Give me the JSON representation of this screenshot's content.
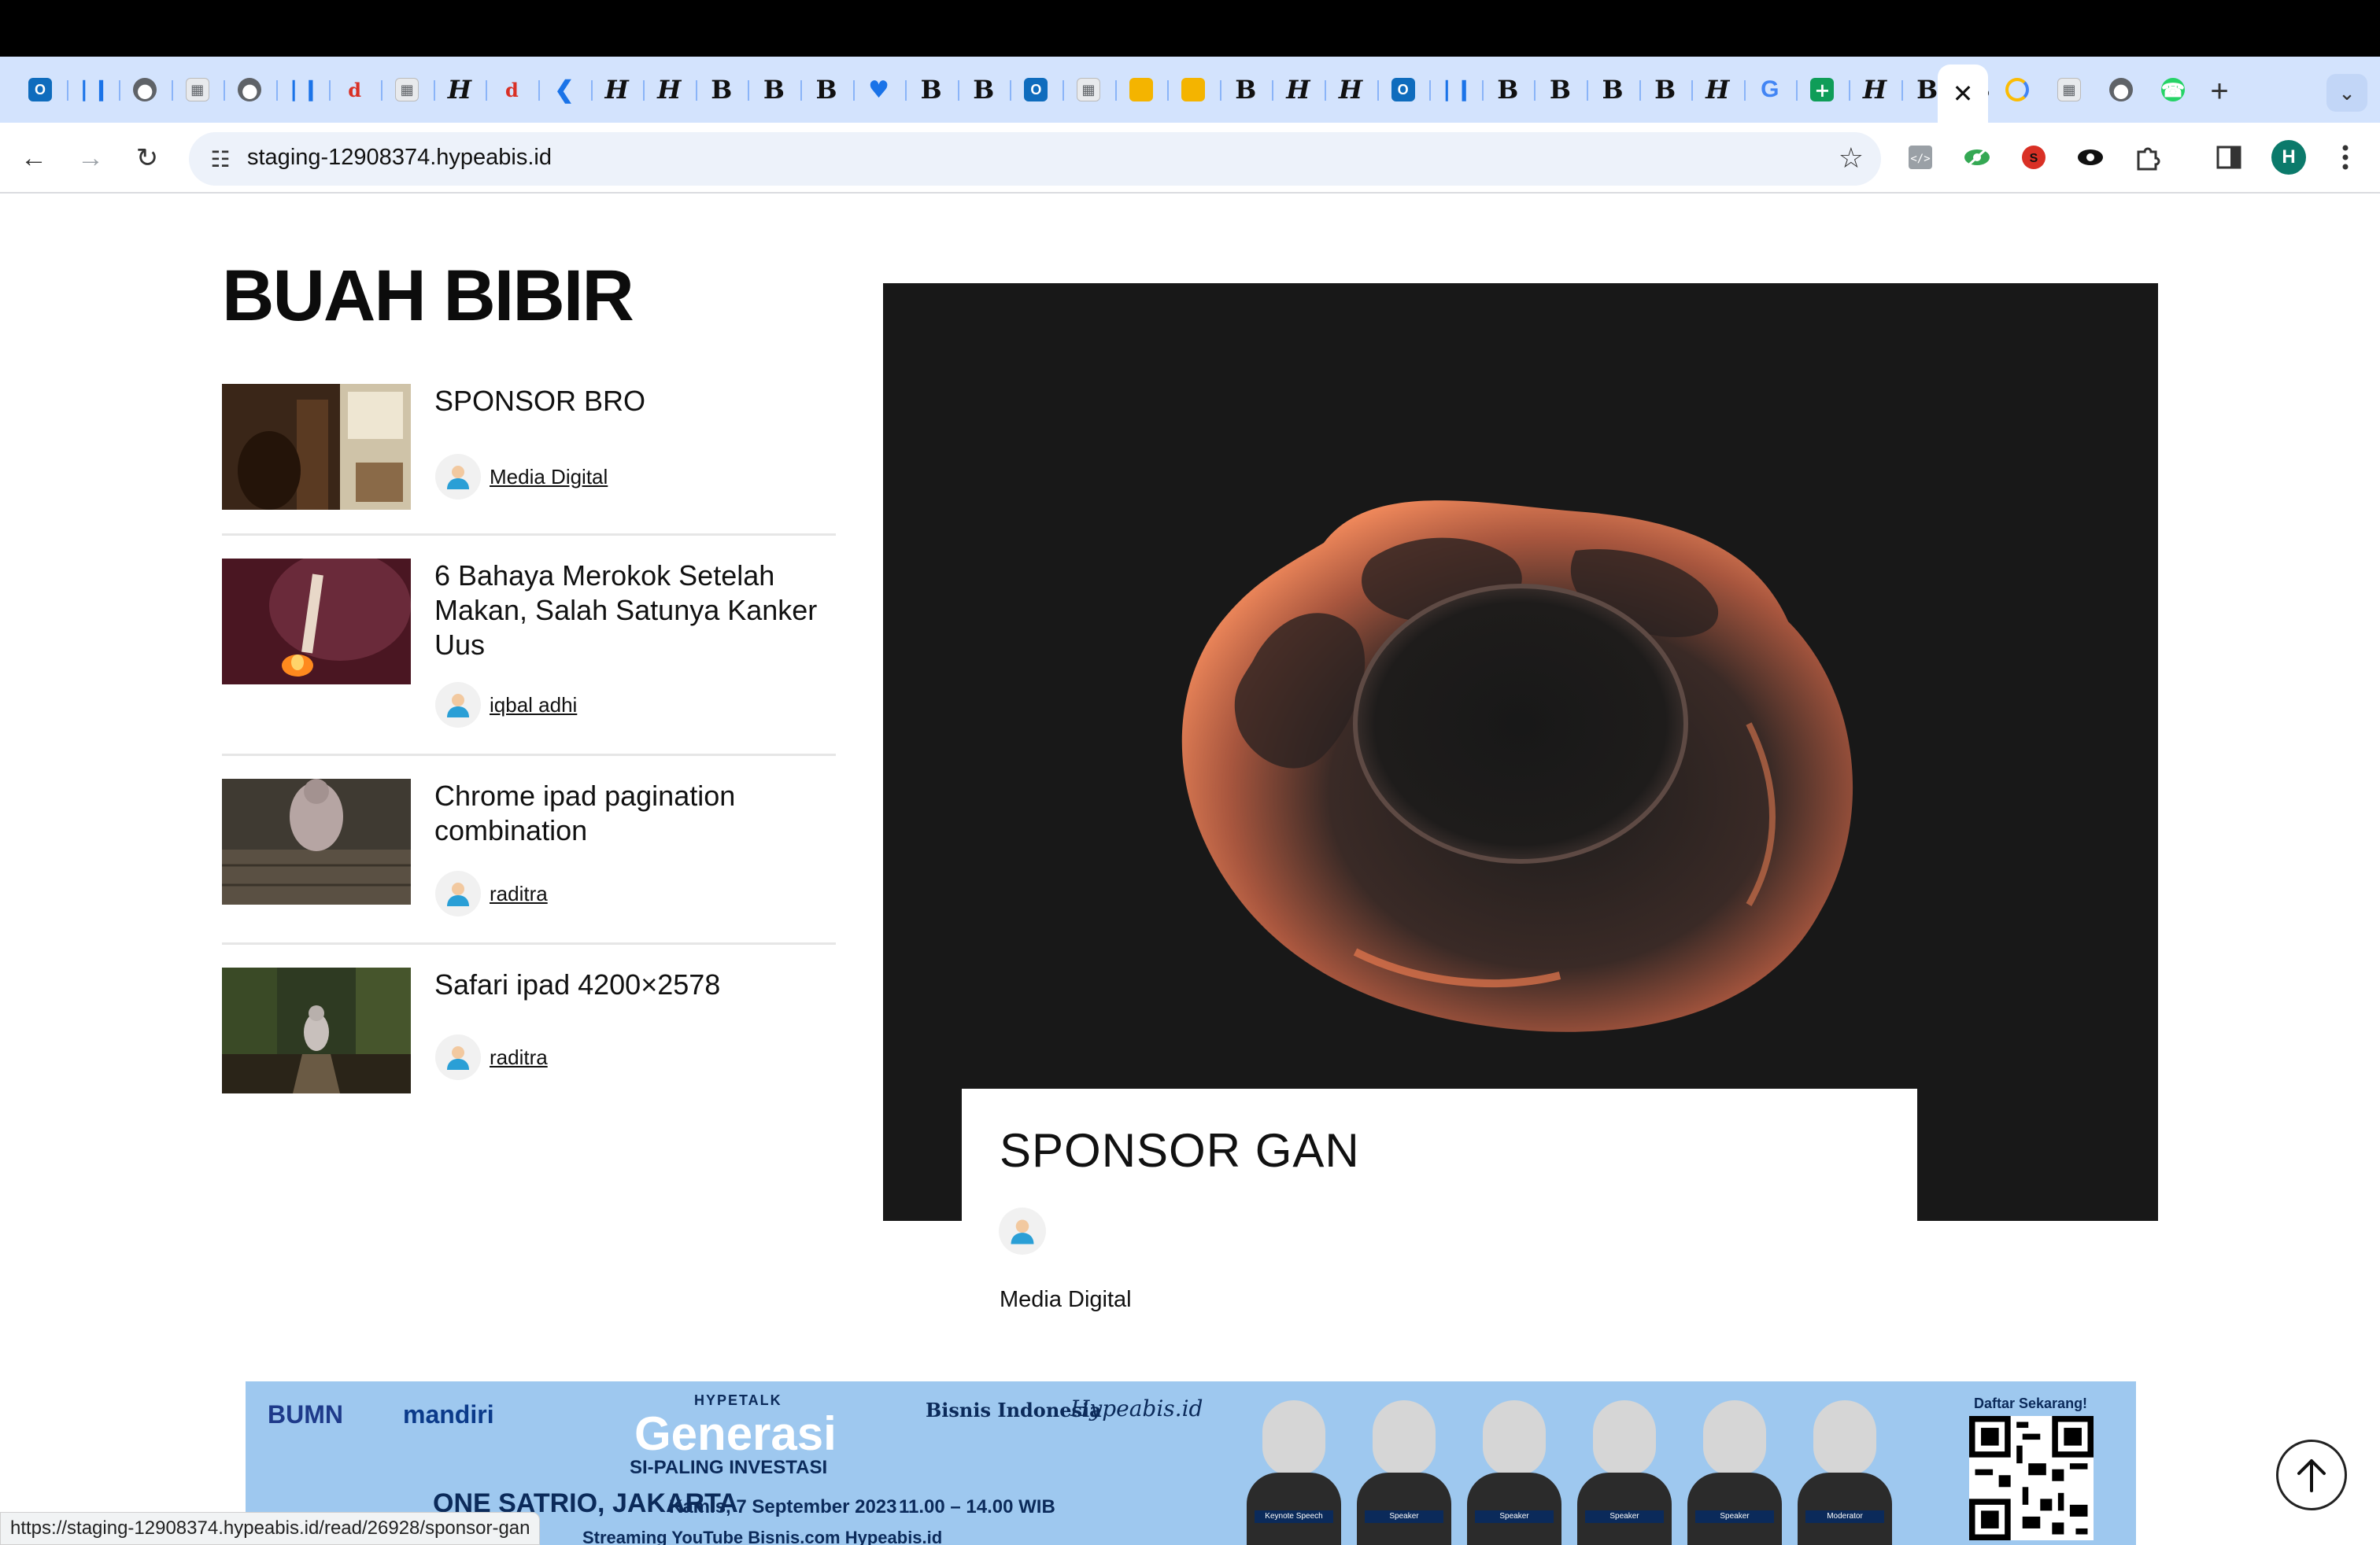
{
  "browser": {
    "tabs": [
      {
        "icon": "outlook-icon",
        "glyph": "O",
        "kind": "ol"
      },
      {
        "icon": "analytics-bars-icon",
        "glyph": "❘❙",
        "kind": "bars"
      },
      {
        "icon": "globe-icon",
        "glyph": "●",
        "kind": "globe"
      },
      {
        "icon": "image-icon",
        "glyph": "▦",
        "kind": "img"
      },
      {
        "icon": "globe-icon",
        "glyph": "●",
        "kind": "globe"
      },
      {
        "icon": "analytics-bars-icon",
        "glyph": "❘❙",
        "kind": "bars"
      },
      {
        "icon": "red-d-icon",
        "glyph": "d",
        "kind": "red"
      },
      {
        "icon": "image-icon",
        "glyph": "▦",
        "kind": "img"
      },
      {
        "icon": "hypeabis-icon",
        "glyph": "H",
        "kind": "hy"
      },
      {
        "icon": "red-d-icon",
        "glyph": "d",
        "kind": "red"
      },
      {
        "icon": "blue-arrow-icon",
        "glyph": "❮",
        "kind": "blue"
      },
      {
        "icon": "hypeabis-icon",
        "glyph": "H",
        "kind": "hy"
      },
      {
        "icon": "hypeabis-icon",
        "glyph": "H",
        "kind": "hy"
      },
      {
        "icon": "bisnis-icon",
        "glyph": "B",
        "kind": "bi"
      },
      {
        "icon": "bisnis-icon",
        "glyph": "B",
        "kind": "bi"
      },
      {
        "icon": "bisnis-icon",
        "glyph": "B",
        "kind": "bi"
      },
      {
        "icon": "heart-icon",
        "glyph": "♥",
        "kind": "heart"
      },
      {
        "icon": "bisnis-icon",
        "glyph": "B",
        "kind": "bi"
      },
      {
        "icon": "bisnis-icon",
        "glyph": "B",
        "kind": "bi"
      },
      {
        "icon": "outlook-icon",
        "glyph": "O",
        "kind": "ol"
      },
      {
        "icon": "image-icon",
        "glyph": "▦",
        "kind": "img"
      },
      {
        "icon": "slides-icon",
        "glyph": "",
        "kind": "slide"
      },
      {
        "icon": "slides-icon",
        "glyph": "",
        "kind": "slide"
      },
      {
        "icon": "bisnis-icon",
        "glyph": "B",
        "kind": "bi"
      },
      {
        "icon": "hypeabis-icon",
        "glyph": "H",
        "kind": "hy"
      },
      {
        "icon": "hypeabis-icon",
        "glyph": "H",
        "kind": "hy"
      },
      {
        "icon": "outlook-icon",
        "glyph": "O",
        "kind": "ol"
      },
      {
        "icon": "analytics-bars-icon",
        "glyph": "❘❙",
        "kind": "bars"
      },
      {
        "icon": "bisnis-icon",
        "glyph": "B",
        "kind": "bi"
      },
      {
        "icon": "bisnis-icon",
        "glyph": "B",
        "kind": "bi"
      },
      {
        "icon": "bisnis-icon",
        "glyph": "B",
        "kind": "bi"
      },
      {
        "icon": "bisnis-icon",
        "glyph": "B",
        "kind": "bi"
      },
      {
        "icon": "hypeabis-icon",
        "glyph": "H",
        "kind": "hy"
      },
      {
        "icon": "google-icon",
        "glyph": "G",
        "kind": "goog"
      },
      {
        "icon": "sheets-icon",
        "glyph": "+",
        "kind": "sheet"
      },
      {
        "icon": "hypeabis-icon",
        "glyph": "H",
        "kind": "hy"
      },
      {
        "icon": "bisnis-icon",
        "glyph": "B",
        "kind": "bi"
      },
      {
        "icon": "bisnis-icon",
        "glyph": "B",
        "kind": "bi"
      }
    ],
    "tabs_after_active": [
      {
        "icon": "loading-icon",
        "glyph": "",
        "kind": "load"
      },
      {
        "icon": "image-icon",
        "glyph": "▦",
        "kind": "img"
      },
      {
        "icon": "chrome-icon",
        "glyph": "●",
        "kind": "chrome"
      },
      {
        "icon": "whatsapp-icon",
        "glyph": "☎",
        "kind": "wa"
      }
    ],
    "active_tab_close": "✕",
    "new_tab": "+",
    "tab_search": "⌄",
    "back": "←",
    "forward": "→",
    "reload": "↻",
    "tune": "☷",
    "url": "staging-12908374.hypeabis.id",
    "bookmark": "☆",
    "profile_initial": "H",
    "status_url": "https://staging-12908374.hypeabis.id/read/26928/sponsor-gan"
  },
  "section": {
    "title": "BUAH BIBIR"
  },
  "articles": [
    {
      "title": "SPONSOR BRO",
      "author": "Media Digital"
    },
    {
      "title": "6 Bahaya Merokok Setelah Makan, Salah Satunya Kanker Uus",
      "author": "iqbal adhi"
    },
    {
      "title": "Chrome ipad pagination combination",
      "author": "raditra"
    },
    {
      "title": "Safari ipad 4200×2578",
      "author": "raditra"
    }
  ],
  "featured": {
    "title": "SPONSOR GAN",
    "author": "Media Digital"
  },
  "banner": {
    "logo1": "BUMN",
    "logo2": "mandiri",
    "kicker": "HYPETALK",
    "title": "Generasi",
    "subtitle": "SI-PALING INVESTASI",
    "venue": "ONE SATRIO, JAKARTA",
    "date": "Kamis, 7 September 2023",
    "time": "11.00 – 14.00 WIB",
    "brand1": "Bisnis Indonesia",
    "brand2": "Hypeabis.id",
    "streaming": "Streaming  YouTube Bisnis.com  Hypeabis.id",
    "cta": "Daftar Sekarang!",
    "speaker_roles": [
      "Keynote Speech",
      "Speaker",
      "Speaker",
      "Speaker",
      "Speaker",
      "Moderator"
    ]
  },
  "colors": {
    "tabstrip": "#d3e3fd",
    "feature_bg": "#181818",
    "banner_bg": "#9ec8ef"
  }
}
